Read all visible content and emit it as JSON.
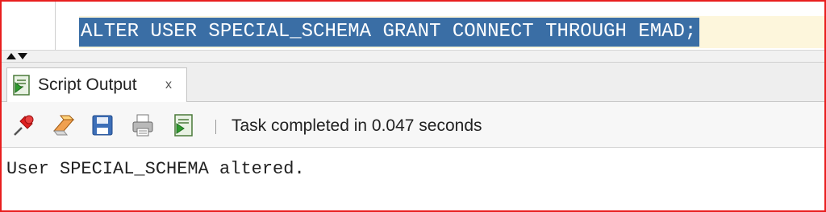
{
  "editor": {
    "sql": "ALTER USER SPECIAL_SCHEMA GRANT CONNECT THROUGH EMAD;"
  },
  "tab": {
    "label": "Script Output",
    "close": "x"
  },
  "toolbar": {
    "buttons": [
      "pin-icon",
      "eraser-icon",
      "save-icon",
      "print-icon",
      "run-script-icon"
    ],
    "status": "Task completed in 0.047 seconds"
  },
  "output": {
    "text": "User SPECIAL_SCHEMA altered."
  }
}
